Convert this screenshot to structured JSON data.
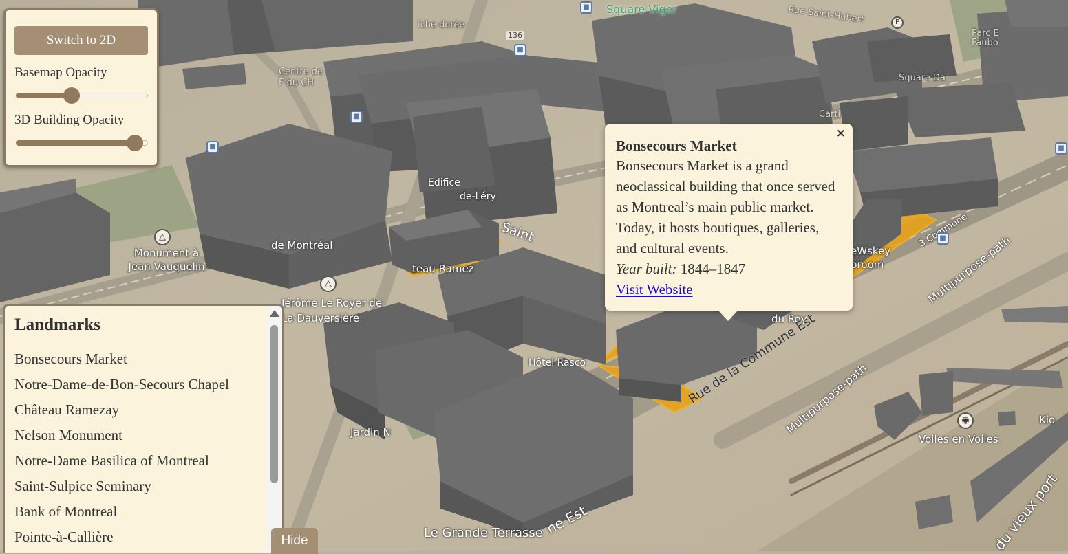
{
  "controls": {
    "switch_label": "Switch to 2D",
    "basemap_label": "Basemap Opacity",
    "basemap_value": 0.42,
    "building_label": "3D Building Opacity",
    "building_value": 0.9,
    "slider_color": "#8f7a5e"
  },
  "landmarks": {
    "title": "Landmarks",
    "items": [
      "Bonsecours Market",
      "Notre-Dame-de-Bon-Secours Chapel",
      "Château Ramezay",
      "Nelson Monument",
      "Notre-Dame Basilica of Montreal",
      "Saint-Sulpice Seminary",
      "Bank of Montreal",
      "Pointe-à-Callière"
    ],
    "hide_label": "Hide"
  },
  "popup": {
    "close": "×",
    "title": "Bonsecours Market",
    "description": "Bonsecours Market is a grand neoclassical building that once served as Montreal’s main public market. Today, it hosts boutiques, galleries, and cultural events.",
    "year_label": "Year built:",
    "year_value": "1844–1847",
    "link_label": "Visit Website"
  },
  "map": {
    "highlight_color": "#e8a21a",
    "labels": {
      "square_viger": "Square Viger",
      "rue_saint_hubert": "Rue Saint-Hubert",
      "parc_faubourg": "Parc E Faubo",
      "square_dalhousie": "Square Da",
      "niche_doree": "iche dorée",
      "route_136": "136",
      "centre_de": "Centre de F du CH",
      "edifice": "Edifice",
      "de_lery": "de-Léry",
      "saint": "Saint",
      "monument_jean": "Monument à Jean Vauquelin",
      "de_montreal": "de Montréal",
      "jerome": "Jérôme Le Royer de La Dauversière",
      "chateau_ramezay_map": "teau Ramez",
      "proom": "eWskey proom",
      "du_roy": "du Roy",
      "rue_commune": "Rue de la Commune Est",
      "multipurpose_1": "Multipurpose-path",
      "multipurpose_2": "Multipurpose-path",
      "multipurpose_3": "Multipurpose-path",
      "jardin": "Jardin N",
      "voiles": "Voiles en Voiles",
      "grande_terrasse": "Le Grande Terrasse",
      "ne_est": "ne Est",
      "du_vieux_port": "du vieux port",
      "kio": "Kio",
      "la_commune": "3 Commune",
      "hotel": "Hôtel Rasco",
      "cartier": "Carti"
    }
  }
}
